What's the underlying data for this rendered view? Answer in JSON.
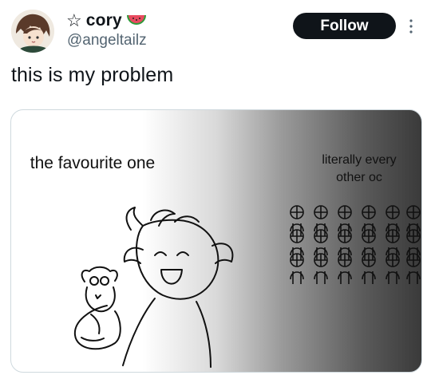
{
  "user": {
    "display_name": "cory",
    "handle": "@angeltailz",
    "star_glyph": "☆",
    "emoji_icon": "watermelon-icon"
  },
  "actions": {
    "follow_label": "Follow",
    "more_icon": "more-vertical-icon"
  },
  "tweet": {
    "text": "this is my problem"
  },
  "media": {
    "caption_left": "the favourite one",
    "caption_right": "literally every other oc"
  },
  "colors": {
    "text": "#0f1419",
    "secondary": "#536471",
    "button_bg": "#0f1419",
    "button_text": "#ffffff",
    "border": "#cfd9de"
  }
}
